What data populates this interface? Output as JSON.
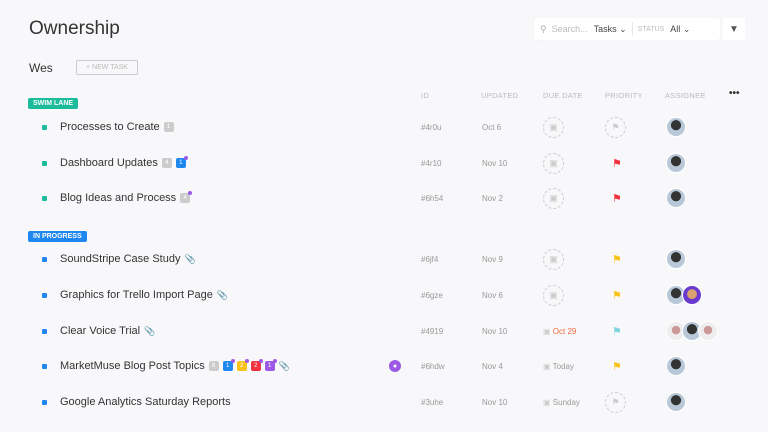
{
  "page": {
    "title": "Ownership",
    "owner": "Wes",
    "new_task": "+ NEW TASK"
  },
  "toolbar": {
    "search_placeholder": "Search...",
    "search_scope": "Tasks",
    "status_label": "STATUS",
    "status_value": "All"
  },
  "columns": {
    "id": "ID",
    "updated": "UPDATED",
    "due": "DUE DATE",
    "priority": "PRIORITY",
    "assignee": "ASSIGNEE",
    "more": "•••"
  },
  "groups": [
    {
      "label": "SWIM LANE",
      "color": "#1bbc9c"
    },
    {
      "label": "IN PROGRESS",
      "color": "#1e88f0"
    }
  ],
  "tasks": [
    {
      "name": "Processes to Create",
      "id": "#4r0u",
      "updated": "Oct 6",
      "badges": [
        "1"
      ]
    },
    {
      "name": "Dashboard Updates",
      "id": "#4r10",
      "updated": "Nov 10",
      "badges": [
        "4",
        "1"
      ],
      "priority": "urgent"
    },
    {
      "name": "Blog Ideas and Process",
      "id": "#6h54",
      "updated": "Nov 2",
      "badges": [
        "4"
      ],
      "priority": "urgent"
    },
    {
      "name": "SoundStripe Case Study",
      "id": "#6jf4",
      "updated": "Nov 9",
      "priority": "high"
    },
    {
      "name": "Graphics for Trello Import Page",
      "id": "#6gze",
      "updated": "Nov 6",
      "priority": "high"
    },
    {
      "name": "Clear Voice Trial",
      "id": "#4919",
      "updated": "Nov 10",
      "due": "Oct 29",
      "priority": "normal"
    },
    {
      "name": "MarketMuse Blog Post Topics",
      "id": "#6hdw",
      "updated": "Nov 4",
      "due": "Today",
      "badges": [
        "6",
        "1",
        "2",
        "2",
        "1"
      ],
      "priority": "high"
    },
    {
      "name": "Google Analytics Saturday Reports",
      "id": "#3uhe",
      "updated": "Nov 10",
      "due": "Sunday"
    }
  ],
  "colors": {
    "urgent": "#f0333f",
    "high": "#f8c21b",
    "normal": "#7fd6e0",
    "overdue": "#f06a3b"
  }
}
